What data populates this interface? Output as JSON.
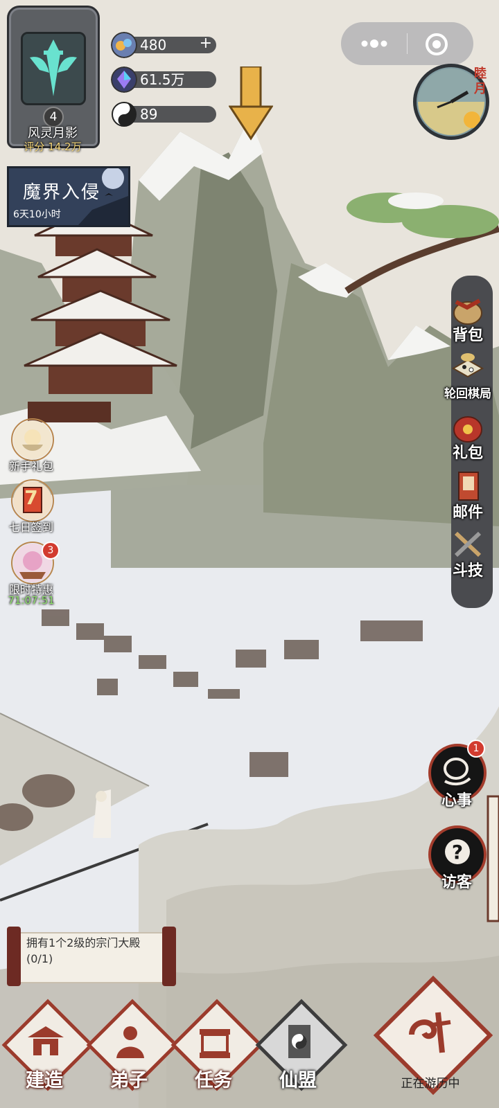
{
  "profile": {
    "level": "4",
    "name": "风灵月影",
    "score": "评分 14.2万"
  },
  "resources": [
    {
      "icon": "stamina-icon",
      "value": "480",
      "has_plus": true
    },
    {
      "icon": "spirit-crystal-icon",
      "value": "61.5万",
      "has_plus": false
    },
    {
      "icon": "yin-yang-icon",
      "value": "89",
      "has_plus": false
    }
  ],
  "clock": {
    "label": "睦月"
  },
  "event": {
    "title": "魔界入侵",
    "timer": "6天10小时"
  },
  "right_menu": [
    {
      "label": "背包",
      "icon": "bag-icon"
    },
    {
      "label": "轮回棋局",
      "icon": "chessboard-icon"
    },
    {
      "label": "礼包",
      "icon": "gift-pack-icon"
    },
    {
      "label": "邮件",
      "icon": "mail-icon"
    },
    {
      "label": "斗技",
      "icon": "crossed-swords-icon"
    }
  ],
  "left_quick": [
    {
      "label": "新手礼包",
      "icon": "newbie-gift-icon"
    },
    {
      "label": "七日签到",
      "icon": "seven-day-checkin-icon",
      "badge_text": "7"
    },
    {
      "label": "限时特惠",
      "icon": "limited-offer-icon",
      "badge": "3",
      "timer": "71:07:51"
    }
  ],
  "right_buttons": [
    {
      "label": "心事",
      "icon": "heart-matter-icon",
      "badge": "1"
    },
    {
      "label": "访客",
      "icon": "visitor-icon"
    }
  ],
  "task": {
    "text": "拥有1个2级的宗门大殿(0/1)"
  },
  "bottom_nav": [
    {
      "label": "建造",
      "icon": "build-icon"
    },
    {
      "label": "弟子",
      "icon": "disciple-icon"
    },
    {
      "label": "任务",
      "icon": "task-icon"
    },
    {
      "label": "仙盟",
      "icon": "alliance-icon"
    }
  ],
  "travel": {
    "label": "正在游历中"
  },
  "colors": {
    "accent_red": "#9b3b2c",
    "panel_gray": "#4a4b4f",
    "mist": "#e9ebef"
  }
}
